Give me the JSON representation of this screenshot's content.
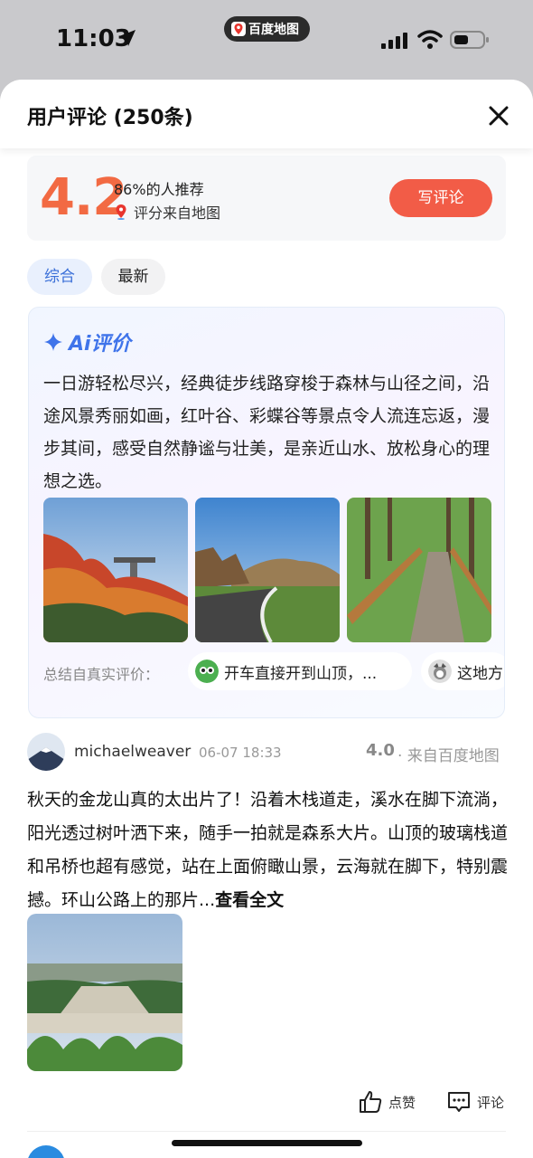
{
  "status_bar": {
    "time": "11:03",
    "app_pill": "百度地图"
  },
  "sheet": {
    "title": "用户评论 (250条)"
  },
  "rating": {
    "score": "4.2",
    "recommend": "86%的人推荐",
    "source": "评分来自地图",
    "write_button": "写评论"
  },
  "tabs": [
    {
      "label": "综合"
    },
    {
      "label": "最新"
    }
  ],
  "ai": {
    "title": "Ai评价",
    "text": "一日游轻松尽兴，经典徒步线路穿梭于森林与山径之间，沿途风景秀丽如画，红叶谷、彩蝶谷等景点令人流连忘返，漫步其间，感受自然静谧与壮美，是亲近山水、放松身心的理想之选。",
    "summary_label": "总结自真实评价：",
    "chips": [
      {
        "text": "开车直接开到山顶，..."
      },
      {
        "text": "这地方"
      }
    ]
  },
  "review": {
    "user": "michaelweaver",
    "time": "06-07 18:33",
    "score": "4.0",
    "source": "· 来自百度地图",
    "text": "秋天的金龙山真的太出片了！沿着木栈道走，溪水在脚下流淌，阳光透过树叶洒下来，随手一拍就是森系大片。山顶的玻璃栈道和吊桥也超有感觉，站在上面俯瞰山景，云海就在脚下，特别震撼。环山公路上的那片...",
    "more": "查看全文",
    "like_label": "点赞",
    "comment_label": "评论"
  },
  "colors": {
    "accent": "#f25c47",
    "score": "#f26a43",
    "ai_blue": "#3f74ea",
    "tab_active": "#3a6fd8"
  }
}
